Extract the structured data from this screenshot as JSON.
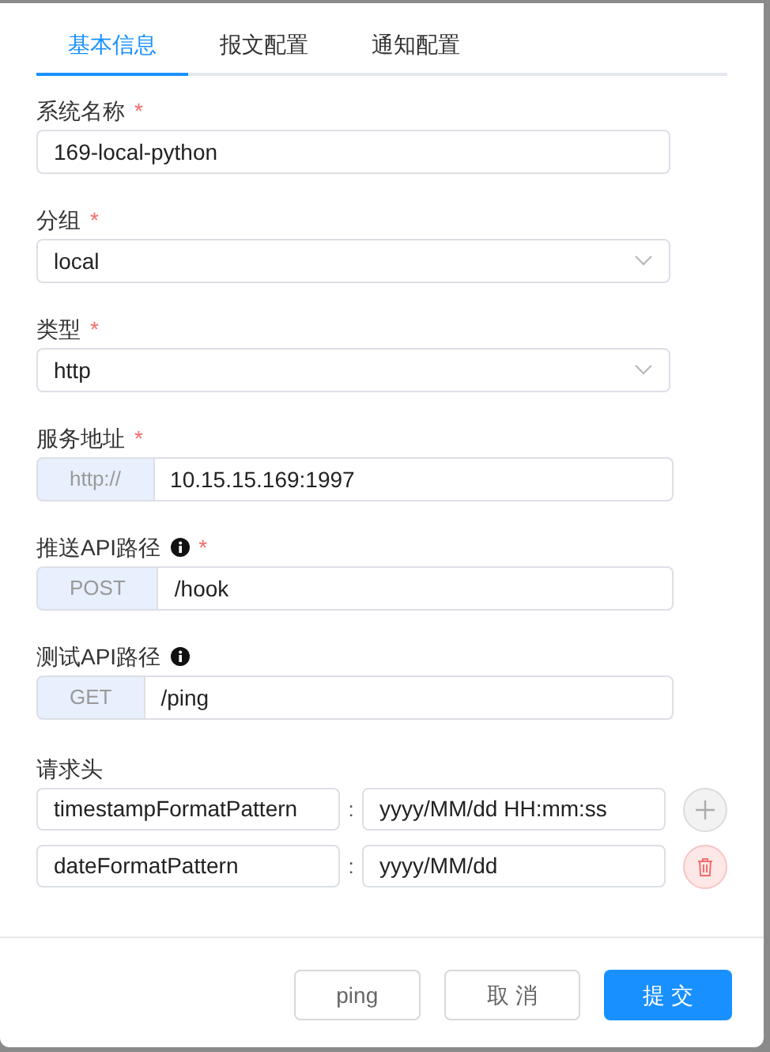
{
  "tabs": [
    {
      "label": "基本信息",
      "selected": true
    },
    {
      "label": "报文配置",
      "selected": false
    },
    {
      "label": "通知配置",
      "selected": false
    }
  ],
  "fields": [
    {
      "kind": "text",
      "label": "系统名称",
      "required_mark": "*",
      "value": "169-local-python"
    },
    {
      "kind": "select",
      "label": "分组",
      "required_mark": "*",
      "value": "local"
    },
    {
      "kind": "select",
      "label": "类型",
      "required_mark": "*",
      "value": "http"
    },
    {
      "kind": "prefixed",
      "label": "服务地址",
      "required_mark": "*",
      "prefix": "http://",
      "value": "10.15.15.169:1997"
    },
    {
      "kind": "prefixed",
      "label": "推送API路径",
      "info": true,
      "required_mark": "*",
      "prefix": "POST",
      "value": "/hook"
    },
    {
      "kind": "prefixed",
      "label": "测试API路径",
      "info": true,
      "prefix": "GET",
      "value": "/ping"
    }
  ],
  "headers": {
    "label": "请求头",
    "rows": [
      {
        "key": "timestampFormatPattern",
        "separator": ":",
        "value": "yyyy/MM/dd HH:mm:ss",
        "kind": "add"
      },
      {
        "key": "dateFormatPattern",
        "separator": ":",
        "value": "yyyy/MM/dd",
        "kind": "delete"
      }
    ]
  },
  "buttons": [
    {
      "label": "ping",
      "kind": "default"
    },
    {
      "label": "取 消",
      "kind": "default"
    },
    {
      "label": "提 交",
      "kind": "primary"
    }
  ]
}
